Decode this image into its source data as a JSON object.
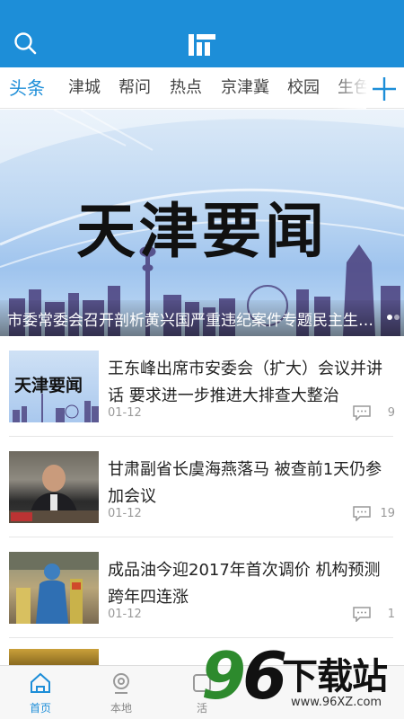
{
  "header": {
    "logo_icon": "app-logo-icon",
    "search_icon": "search-icon",
    "color": "#1d8ed8"
  },
  "tabs": [
    {
      "label": "头条",
      "active": true
    },
    {
      "label": "津城"
    },
    {
      "label": "帮问"
    },
    {
      "label": "热点"
    },
    {
      "label": "京津冀"
    },
    {
      "label": "校园"
    },
    {
      "label": "生色"
    }
  ],
  "add_tab_icon": "plus-icon",
  "banner": {
    "title": "天津要闻",
    "caption": "市委常委会召开剖析黄兴国严重违纪案件专题民主生活会"
  },
  "news": [
    {
      "title": "王东峰出席市安委会（扩大）会议并讲话 要求进一步推进大排查大整治",
      "date": "01-12",
      "comments": "9",
      "thumb_text": "天津要闻"
    },
    {
      "title": "甘肃副省长虞海燕落马 被查前1天仍参加会议",
      "date": "01-12",
      "comments": "19"
    },
    {
      "title": "成品油今迎2017年首次调价 机构预测跨年四连涨",
      "date": "01-12",
      "comments": "1"
    }
  ],
  "bottom_nav": [
    {
      "label": "首页",
      "icon": "home-icon",
      "active": true
    },
    {
      "label": "本地",
      "icon": "location-icon"
    },
    {
      "label": "活",
      "icon": "life-icon"
    }
  ],
  "watermark": {
    "digits": [
      "9",
      "6"
    ],
    "text": "下载站",
    "url": "www.96XZ.com"
  }
}
